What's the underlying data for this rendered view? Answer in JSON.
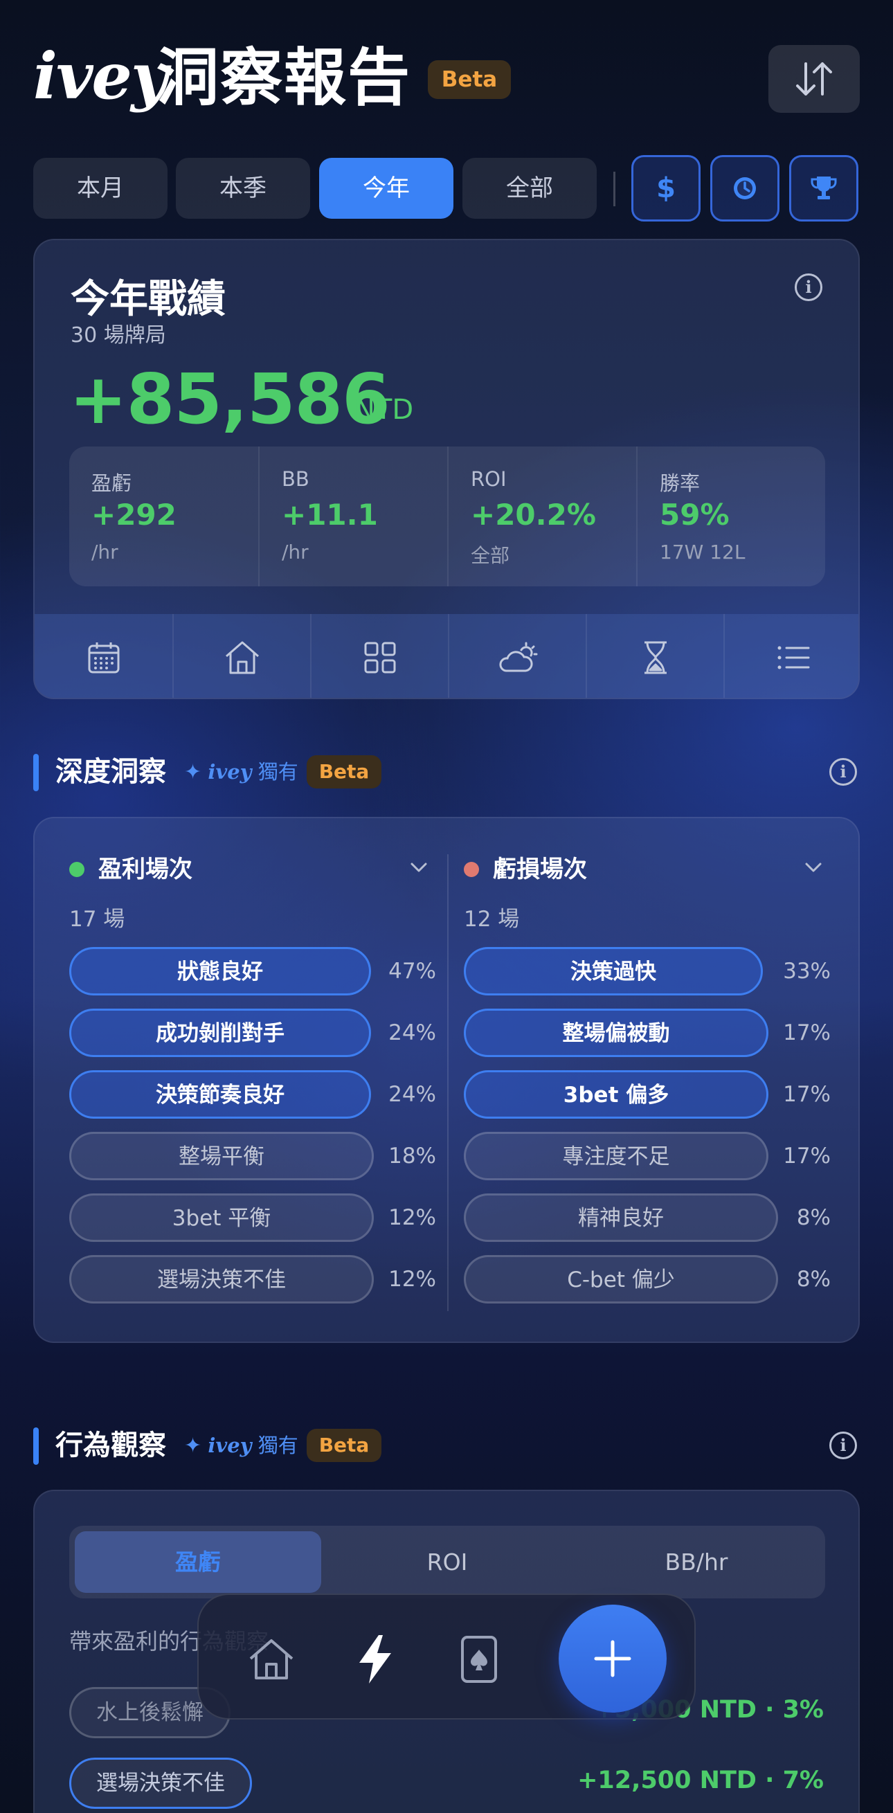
{
  "header": {
    "brand": "ivey",
    "title": "洞察報告",
    "beta": "Beta"
  },
  "period_tabs": [
    {
      "label": "本月",
      "active": false
    },
    {
      "label": "本季",
      "active": false
    },
    {
      "label": "今年",
      "active": true
    },
    {
      "label": "全部",
      "active": false
    }
  ],
  "filter_icons": [
    "dollar-icon",
    "clock-icon",
    "trophy-icon"
  ],
  "summary": {
    "title": "今年戰績",
    "subtitle": "30 場牌局",
    "value": "+85,586",
    "unit": "NTD",
    "metrics": [
      {
        "label": "盈虧",
        "value": "+292",
        "sub": "/hr"
      },
      {
        "label": "BB",
        "value": "+11.1",
        "sub": "/hr"
      },
      {
        "label": "ROI",
        "value": "+20.2%",
        "sub": "全部"
      },
      {
        "label": "勝率",
        "value": "59%",
        "sub": "17W 12L"
      }
    ],
    "tools": [
      "calendar-icon",
      "home-icon",
      "grid-icon",
      "weather-icon",
      "hourglass-icon",
      "list-icon"
    ]
  },
  "insight": {
    "title": "深度洞察",
    "exclusive_brand": "ivey",
    "exclusive_label": "獨有",
    "beta": "Beta",
    "profit": {
      "title": "盈利場次",
      "count": "17 場",
      "color": "#4dcc6a",
      "tags": [
        {
          "label": "狀態良好",
          "pct": "47%",
          "highlight": true
        },
        {
          "label": "成功剝削對手",
          "pct": "24%",
          "highlight": true
        },
        {
          "label": "決策節奏良好",
          "pct": "24%",
          "highlight": true
        },
        {
          "label": "整場平衡",
          "pct": "18%",
          "highlight": false
        },
        {
          "label": "3bet 平衡",
          "pct": "12%",
          "highlight": false
        },
        {
          "label": "選場決策不佳",
          "pct": "12%",
          "highlight": false
        }
      ]
    },
    "loss": {
      "title": "虧損場次",
      "count": "12 場",
      "color": "#e07a70",
      "tags": [
        {
          "label": "決策過快",
          "pct": "33%",
          "highlight": true
        },
        {
          "label": "整場偏被動",
          "pct": "17%",
          "highlight": true
        },
        {
          "label": "3bet 偏多",
          "pct": "17%",
          "highlight": true
        },
        {
          "label": "專注度不足",
          "pct": "17%",
          "highlight": false
        },
        {
          "label": "精神良好",
          "pct": "8%",
          "highlight": false
        },
        {
          "label": "C-bet 偏少",
          "pct": "8%",
          "highlight": false
        }
      ]
    }
  },
  "behavior": {
    "title": "行為觀察",
    "exclusive_brand": "ivey",
    "exclusive_label": "獨有",
    "beta": "Beta",
    "segments": [
      {
        "label": "盈虧",
        "active": true
      },
      {
        "label": "ROI",
        "active": false
      },
      {
        "label": "BB/hr",
        "active": false
      }
    ],
    "section_label": "帶來盈利的行為觀察",
    "rows": [
      {
        "tag": "水上後鬆懈",
        "value": "+5,000 NTD · 3%",
        "highlight": false
      },
      {
        "tag": "選場決策不佳",
        "value": "+12,500 NTD · 7%",
        "highlight": true
      }
    ]
  },
  "bottom_nav": [
    "home-icon",
    "bolt-icon",
    "card-icon",
    "plus-icon"
  ]
}
